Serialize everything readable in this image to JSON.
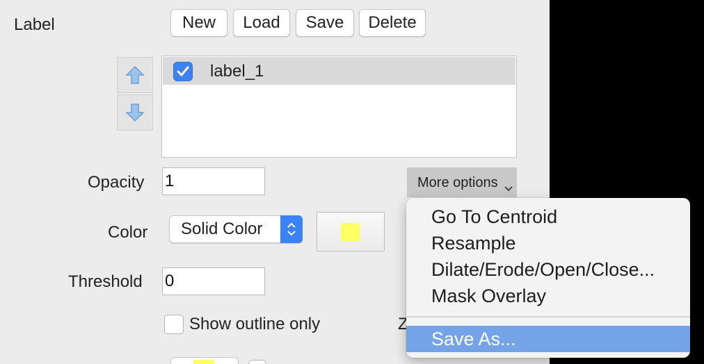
{
  "panel": {
    "section_label": "Label"
  },
  "toolbar": {
    "new_label": "New",
    "load_label": "Load",
    "save_label": "Save",
    "delete_label": "Delete"
  },
  "label_list": {
    "items": [
      {
        "name": "label_1",
        "checked": true
      }
    ],
    "up_icon": "arrow-up-icon",
    "down_icon": "arrow-down-icon"
  },
  "opacity": {
    "label": "Opacity",
    "value": "1"
  },
  "more_options": {
    "label": "More options",
    "icon": "chevron-down-icon"
  },
  "color": {
    "label": "Color",
    "mode": "Solid Color",
    "swatch": "#ffff66"
  },
  "threshold": {
    "label": "Threshold",
    "value": "0"
  },
  "outline": {
    "label": "Show outline only",
    "checked": false
  },
  "partial_label": "Z",
  "context_menu": {
    "items": [
      "Go To Centroid",
      "Resample",
      "Dilate/Erode/Open/Close...",
      "Mask Overlay"
    ],
    "save_as": "Save As..."
  },
  "colors": {
    "accent": "#3b82f6",
    "menu_highlight": "#75a3e8",
    "panel_bg": "#ececec"
  }
}
